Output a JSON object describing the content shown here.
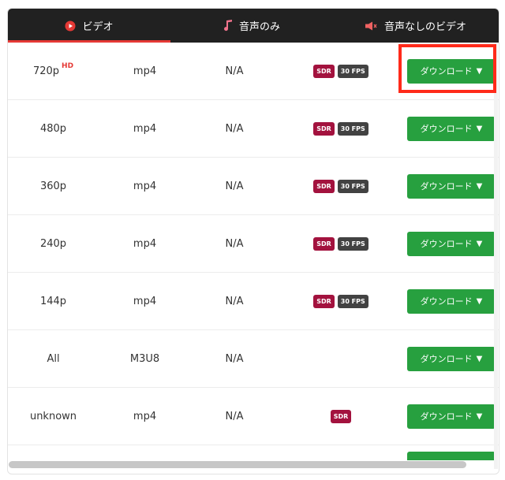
{
  "tabs": [
    {
      "label": "ビデオ",
      "icon": "video-circle-icon",
      "active": true
    },
    {
      "label": "音声のみ",
      "icon": "music-note-icon",
      "active": false
    },
    {
      "label": "音声なしのビデオ",
      "icon": "muted-speaker-icon",
      "active": false
    }
  ],
  "rows": [
    {
      "quality": "720p",
      "hd": "HD",
      "format": "mp4",
      "size": "N/A",
      "sdr": "SDR",
      "fps": "30 FPS",
      "download": "ダウンロード",
      "arrow": "▼"
    },
    {
      "quality": "480p",
      "format": "mp4",
      "size": "N/A",
      "sdr": "SDR",
      "fps": "30 FPS",
      "download": "ダウンロード",
      "arrow": "▼"
    },
    {
      "quality": "360p",
      "format": "mp4",
      "size": "N/A",
      "sdr": "SDR",
      "fps": "30 FPS",
      "download": "ダウンロード",
      "arrow": "▼"
    },
    {
      "quality": "240p",
      "format": "mp4",
      "size": "N/A",
      "sdr": "SDR",
      "fps": "30 FPS",
      "download": "ダウンロード",
      "arrow": "▼"
    },
    {
      "quality": "144p",
      "format": "mp4",
      "size": "N/A",
      "sdr": "SDR",
      "fps": "30 FPS",
      "download": "ダウンロード",
      "arrow": "▼"
    },
    {
      "quality": "All",
      "format": "M3U8",
      "size": "N/A",
      "download": "ダウンロード",
      "arrow": "▼"
    },
    {
      "quality": "unknown",
      "format": "mp4",
      "size": "N/A",
      "sdr": "SDR",
      "download": "ダウンロード",
      "arrow": "▼"
    }
  ],
  "colors": {
    "tab_bar": "#212121",
    "active_underline": "#e53935",
    "download": "#27a03f",
    "sdr": "#a3123e",
    "fps": "#424242",
    "highlight": "#ff2a1a"
  }
}
